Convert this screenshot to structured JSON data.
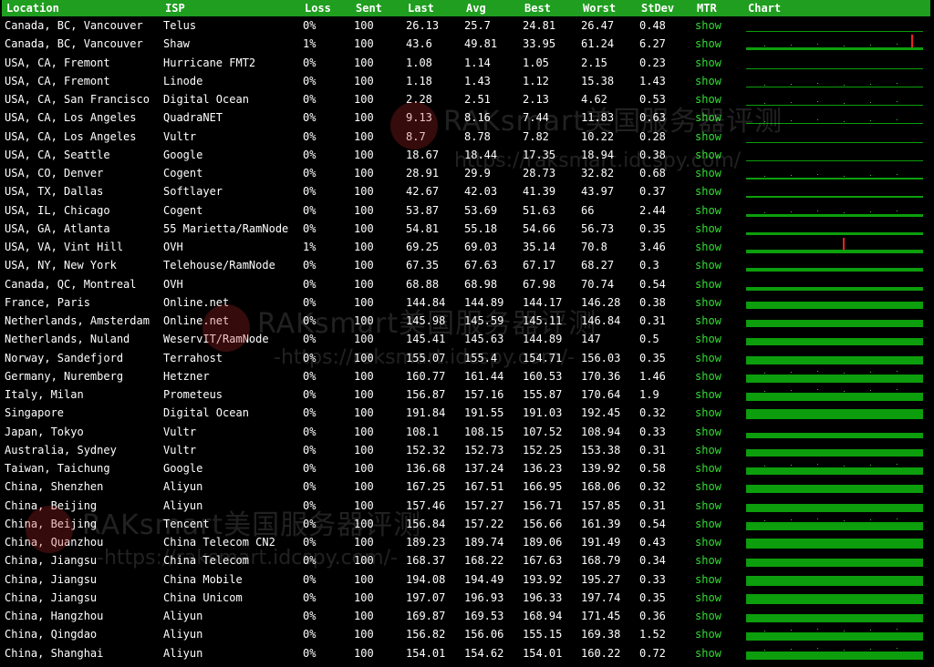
{
  "header": {
    "location": "Location",
    "isp": "ISP",
    "loss": "Loss",
    "sent": "Sent",
    "last": "Last",
    "avg": "Avg",
    "best": "Best",
    "worst": "Worst",
    "stdev": "StDev",
    "mtr": "MTR",
    "chart": "Chart"
  },
  "rows": [
    {
      "location": "Canada, BC, Vancouver",
      "isp": "Telus",
      "loss": "0%",
      "sent": "100",
      "last": "26.13",
      "avg": "25.7",
      "best": "24.81",
      "worst": "26.47",
      "stdev": "0.48",
      "mtr": "show"
    },
    {
      "location": "Canada, BC, Vancouver",
      "isp": "Shaw",
      "loss": "1%",
      "sent": "100",
      "last": "43.6",
      "avg": "49.81",
      "best": "33.95",
      "worst": "61.24",
      "stdev": "6.27",
      "mtr": "show"
    },
    {
      "location": "USA, CA, Fremont",
      "isp": "Hurricane FMT2",
      "loss": "0%",
      "sent": "100",
      "last": "1.08",
      "avg": "1.14",
      "best": "1.05",
      "worst": "2.15",
      "stdev": "0.23",
      "mtr": "show"
    },
    {
      "location": "USA, CA, Fremont",
      "isp": "Linode",
      "loss": "0%",
      "sent": "100",
      "last": "1.18",
      "avg": "1.43",
      "best": "1.12",
      "worst": "15.38",
      "stdev": "1.43",
      "mtr": "show"
    },
    {
      "location": "USA, CA, San Francisco",
      "isp": "Digital Ocean",
      "loss": "0%",
      "sent": "100",
      "last": "2.28",
      "avg": "2.51",
      "best": "2.13",
      "worst": "4.62",
      "stdev": "0.53",
      "mtr": "show"
    },
    {
      "location": "USA, CA, Los Angeles",
      "isp": "QuadraNET",
      "loss": "0%",
      "sent": "100",
      "last": "9.13",
      "avg": "8.16",
      "best": "7.44",
      "worst": "11.83",
      "stdev": "0.63",
      "mtr": "show"
    },
    {
      "location": "USA, CA, Los Angeles",
      "isp": "Vultr",
      "loss": "0%",
      "sent": "100",
      "last": "8.7",
      "avg": "8.78",
      "best": "7.82",
      "worst": "10.22",
      "stdev": "0.28",
      "mtr": "show"
    },
    {
      "location": "USA, CA, Seattle",
      "isp": "Google",
      "loss": "0%",
      "sent": "100",
      "last": "18.67",
      "avg": "18.44",
      "best": "17.35",
      "worst": "18.94",
      "stdev": "0.38",
      "mtr": "show"
    },
    {
      "location": "USA, CO, Denver",
      "isp": "Cogent",
      "loss": "0%",
      "sent": "100",
      "last": "28.91",
      "avg": "29.9",
      "best": "28.73",
      "worst": "32.82",
      "stdev": "0.68",
      "mtr": "show"
    },
    {
      "location": "USA, TX, Dallas",
      "isp": "Softlayer",
      "loss": "0%",
      "sent": "100",
      "last": "42.67",
      "avg": "42.03",
      "best": "41.39",
      "worst": "43.97",
      "stdev": "0.37",
      "mtr": "show"
    },
    {
      "location": "USA, IL, Chicago",
      "isp": "Cogent",
      "loss": "0%",
      "sent": "100",
      "last": "53.87",
      "avg": "53.69",
      "best": "51.63",
      "worst": "66",
      "stdev": "2.44",
      "mtr": "show"
    },
    {
      "location": "USA, GA, Atlanta",
      "isp": "55 Marietta/RamNode",
      "loss": "0%",
      "sent": "100",
      "last": "54.81",
      "avg": "55.18",
      "best": "54.66",
      "worst": "56.73",
      "stdev": "0.35",
      "mtr": "show"
    },
    {
      "location": "USA, VA, Vint Hill",
      "isp": "OVH",
      "loss": "1%",
      "sent": "100",
      "last": "69.25",
      "avg": "69.03",
      "best": "35.14",
      "worst": "70.8",
      "stdev": "3.46",
      "mtr": "show"
    },
    {
      "location": "USA, NY, New York",
      "isp": "Telehouse/RamNode",
      "loss": "0%",
      "sent": "100",
      "last": "67.35",
      "avg": "67.63",
      "best": "67.17",
      "worst": "68.27",
      "stdev": "0.3",
      "mtr": "show"
    },
    {
      "location": "Canada, QC, Montreal",
      "isp": "OVH",
      "loss": "0%",
      "sent": "100",
      "last": "68.88",
      "avg": "68.98",
      "best": "67.98",
      "worst": "70.74",
      "stdev": "0.54",
      "mtr": "show"
    },
    {
      "location": "France, Paris",
      "isp": "Online.net",
      "loss": "0%",
      "sent": "100",
      "last": "144.84",
      "avg": "144.89",
      "best": "144.17",
      "worst": "146.28",
      "stdev": "0.38",
      "mtr": "show"
    },
    {
      "location": "Netherlands, Amsterdam",
      "isp": "Online.net",
      "loss": "0%",
      "sent": "100",
      "last": "145.98",
      "avg": "145.59",
      "best": "145.11",
      "worst": "146.84",
      "stdev": "0.31",
      "mtr": "show"
    },
    {
      "location": "Netherlands, Nuland",
      "isp": "WeservIT/RamNode",
      "loss": "0%",
      "sent": "100",
      "last": "145.41",
      "avg": "145.63",
      "best": "144.89",
      "worst": "147",
      "stdev": "0.5",
      "mtr": "show"
    },
    {
      "location": "Norway, Sandefjord",
      "isp": "Terrahost",
      "loss": "0%",
      "sent": "100",
      "last": "155.07",
      "avg": "155.4",
      "best": "154.71",
      "worst": "156.03",
      "stdev": "0.35",
      "mtr": "show"
    },
    {
      "location": "Germany, Nuremberg",
      "isp": "Hetzner",
      "loss": "0%",
      "sent": "100",
      "last": "160.77",
      "avg": "161.44",
      "best": "160.53",
      "worst": "170.36",
      "stdev": "1.46",
      "mtr": "show"
    },
    {
      "location": "Italy, Milan",
      "isp": "Prometeus",
      "loss": "0%",
      "sent": "100",
      "last": "156.87",
      "avg": "157.16",
      "best": "155.87",
      "worst": "170.64",
      "stdev": "1.9",
      "mtr": "show"
    },
    {
      "location": "Singapore",
      "isp": "Digital Ocean",
      "loss": "0%",
      "sent": "100",
      "last": "191.84",
      "avg": "191.55",
      "best": "191.03",
      "worst": "192.45",
      "stdev": "0.32",
      "mtr": "show"
    },
    {
      "location": "Japan, Tokyo",
      "isp": "Vultr",
      "loss": "0%",
      "sent": "100",
      "last": "108.1",
      "avg": "108.15",
      "best": "107.52",
      "worst": "108.94",
      "stdev": "0.33",
      "mtr": "show"
    },
    {
      "location": "Australia, Sydney",
      "isp": "Vultr",
      "loss": "0%",
      "sent": "100",
      "last": "152.32",
      "avg": "152.73",
      "best": "152.25",
      "worst": "153.38",
      "stdev": "0.31",
      "mtr": "show"
    },
    {
      "location": "Taiwan, Taichung",
      "isp": "Google",
      "loss": "0%",
      "sent": "100",
      "last": "136.68",
      "avg": "137.24",
      "best": "136.23",
      "worst": "139.92",
      "stdev": "0.58",
      "mtr": "show"
    },
    {
      "location": "China, Shenzhen",
      "isp": "Aliyun",
      "loss": "0%",
      "sent": "100",
      "last": "167.25",
      "avg": "167.51",
      "best": "166.95",
      "worst": "168.06",
      "stdev": "0.32",
      "mtr": "show"
    },
    {
      "location": "China, Beijing",
      "isp": "Aliyun",
      "loss": "0%",
      "sent": "100",
      "last": "157.46",
      "avg": "157.27",
      "best": "156.71",
      "worst": "157.85",
      "stdev": "0.31",
      "mtr": "show"
    },
    {
      "location": "China, Beijing",
      "isp": "Tencent",
      "loss": "0%",
      "sent": "100",
      "last": "156.84",
      "avg": "157.22",
      "best": "156.66",
      "worst": "161.39",
      "stdev": "0.54",
      "mtr": "show"
    },
    {
      "location": "China, Quanzhou",
      "isp": "China Telecom CN2",
      "loss": "0%",
      "sent": "100",
      "last": "189.23",
      "avg": "189.74",
      "best": "189.06",
      "worst": "191.49",
      "stdev": "0.43",
      "mtr": "show"
    },
    {
      "location": "China, Jiangsu",
      "isp": "China Telecom",
      "loss": "0%",
      "sent": "100",
      "last": "168.37",
      "avg": "168.22",
      "best": "167.63",
      "worst": "168.79",
      "stdev": "0.34",
      "mtr": "show"
    },
    {
      "location": "China, Jiangsu",
      "isp": "China Mobile",
      "loss": "0%",
      "sent": "100",
      "last": "194.08",
      "avg": "194.49",
      "best": "193.92",
      "worst": "195.27",
      "stdev": "0.33",
      "mtr": "show"
    },
    {
      "location": "China, Jiangsu",
      "isp": "China Unicom",
      "loss": "0%",
      "sent": "100",
      "last": "197.07",
      "avg": "196.93",
      "best": "196.33",
      "worst": "197.74",
      "stdev": "0.35",
      "mtr": "show"
    },
    {
      "location": "China, Hangzhou",
      "isp": "Aliyun",
      "loss": "0%",
      "sent": "100",
      "last": "169.87",
      "avg": "169.53",
      "best": "168.94",
      "worst": "171.45",
      "stdev": "0.36",
      "mtr": "show"
    },
    {
      "location": "China, Qingdao",
      "isp": "Aliyun",
      "loss": "0%",
      "sent": "100",
      "last": "156.82",
      "avg": "156.06",
      "best": "155.15",
      "worst": "169.38",
      "stdev": "1.52",
      "mtr": "show"
    },
    {
      "location": "China, Shanghai",
      "isp": "Aliyun",
      "loss": "0%",
      "sent": "100",
      "last": "154.01",
      "avg": "154.62",
      "best": "154.01",
      "worst": "160.22",
      "stdev": "0.72",
      "mtr": "show"
    }
  ],
  "watermarks": [
    {
      "title": "RAKsmart美国服务器评测",
      "url": "https://raksmart.idcspy.com/"
    },
    {
      "title": "RAKsmart美国服务器评测",
      "url": "-https://raksmart.idcspy.com/-"
    },
    {
      "title": "RAKsmart美国服务器评测",
      "url": "-https://raksmart.idcspy.com/-"
    }
  ],
  "colors": {
    "header_bg": "#1f9e1f",
    "mtr_link": "#33dd33",
    "chart_bar": "#0c9e0c",
    "chart_spike": "#ee2222"
  }
}
